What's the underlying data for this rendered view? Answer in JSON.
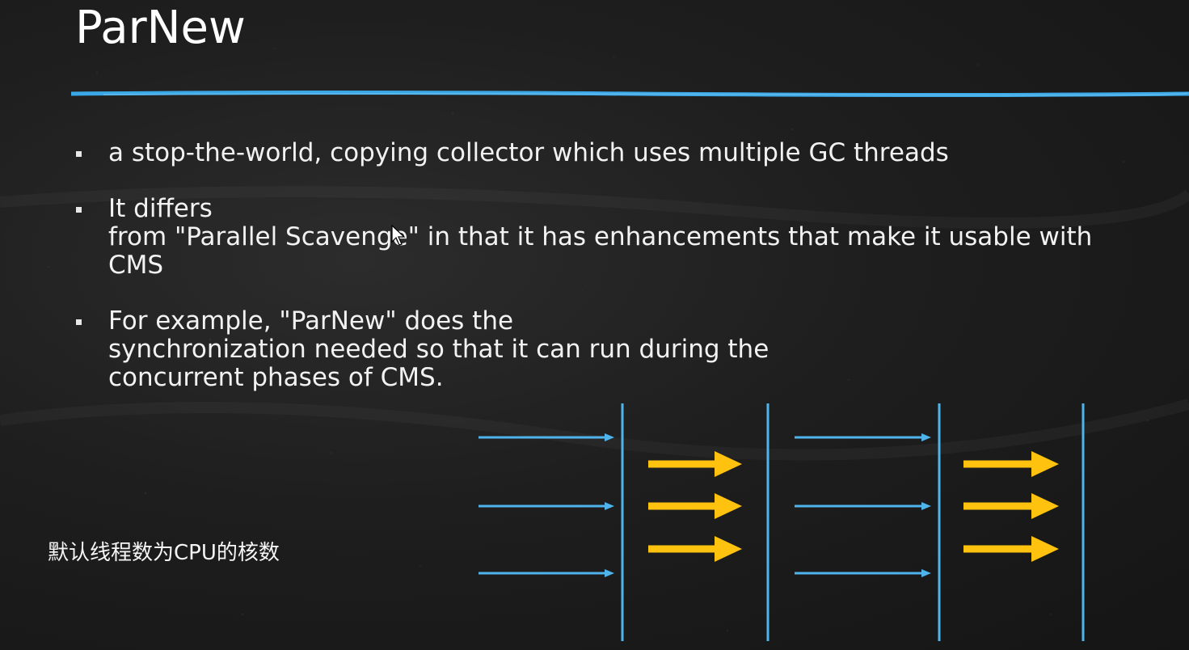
{
  "slide": {
    "title": "ParNew",
    "bullets": [
      {
        "lines": [
          "a stop-the-world, copying collector which uses multiple GC threads"
        ]
      },
      {
        "lines": [
          "It differs",
          "from \"Parallel Scavenge\" in that it has enhancements that make it usable with",
          "CMS"
        ]
      },
      {
        "lines": [
          "For example, \"ParNew\" does the",
          "synchronization needed so that it can run during the",
          "concurrent phases of CMS."
        ]
      }
    ],
    "footnote": "默认线程数为CPU的核数"
  },
  "diagram": {
    "colors": {
      "app_thread": "#4fb3ec",
      "gc_thread": "#ffc20e",
      "safepoint_line": "#4fb3ec",
      "title_rule": "#3aa7e6"
    },
    "phases": [
      "application",
      "gc",
      "application",
      "gc"
    ],
    "app_thread_count": 3,
    "gc_thread_count": 3
  }
}
